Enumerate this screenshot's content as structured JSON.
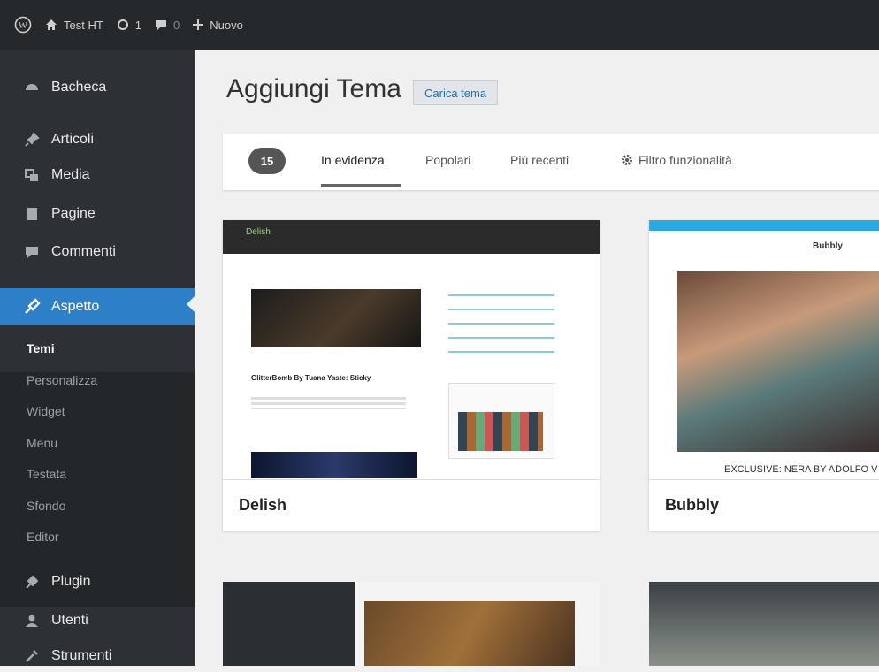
{
  "adminbar": {
    "site_name": "Test HT",
    "updates_count": "1",
    "comments_count": "0",
    "new_label": "Nuovo"
  },
  "sidebar": {
    "items": [
      {
        "label": "Bacheca",
        "icon": "dashboard-icon"
      },
      {
        "label": "Articoli",
        "icon": "pin-icon"
      },
      {
        "label": "Media",
        "icon": "media-icon"
      },
      {
        "label": "Pagine",
        "icon": "pages-icon"
      },
      {
        "label": "Commenti",
        "icon": "comments-icon"
      },
      {
        "label": "Aspetto",
        "icon": "appearance-icon",
        "active": true
      },
      {
        "label": "Plugin",
        "icon": "plugin-icon"
      },
      {
        "label": "Utenti",
        "icon": "users-icon"
      },
      {
        "label": "Strumenti",
        "icon": "tools-icon"
      }
    ],
    "submenu": [
      "Temi",
      "Personalizza",
      "Widget",
      "Menu",
      "Testata",
      "Sfondo",
      "Editor"
    ]
  },
  "main": {
    "title": "Aggiungi Tema",
    "upload_label": "Carica tema",
    "count": "15",
    "tabs": [
      "In evidenza",
      "Popolari",
      "Più recenti"
    ],
    "filter_label": "Filtro funzionalità"
  },
  "themes": [
    {
      "name": "Delish",
      "preview": {
        "logo": "Delish",
        "post_title": "GlitterBomb By Tuana Yaste: Sticky"
      }
    },
    {
      "name": "Bubbly",
      "preview": {
        "logo": "Bubbly",
        "caption": "EXCLUSIVE: NERA BY ADOLFO V"
      }
    }
  ],
  "colors": {
    "adminbar": "#26292c",
    "sidebar": "#2d3135",
    "active_menu": "#2d7fc7",
    "background": "#f0f0f0"
  }
}
